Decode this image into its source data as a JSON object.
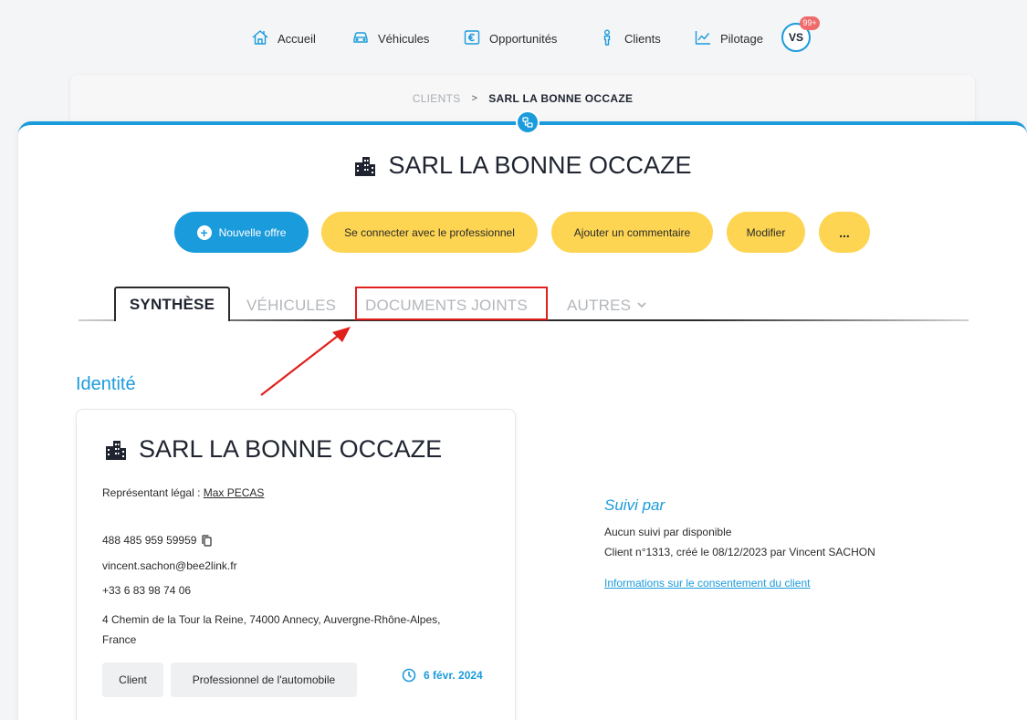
{
  "nav": {
    "items": [
      {
        "label": "Accueil",
        "icon": "home-icon"
      },
      {
        "label": "Véhicules",
        "icon": "car-icon"
      },
      {
        "label": "Opportunités",
        "icon": "euro-icon"
      },
      {
        "label": "Clients",
        "icon": "person-icon"
      },
      {
        "label": "Pilotage",
        "icon": "chart-icon"
      }
    ],
    "avatar_initials": "VS",
    "notification_count": "99+"
  },
  "breadcrumb": {
    "parent": "CLIENTS",
    "separator": ">",
    "current": "SARL LA BONNE OCCAZE"
  },
  "page": {
    "title": "SARL LA BONNE OCCAZE"
  },
  "actions": {
    "new_offer": "Nouvelle offre",
    "connect": "Se connecter avec le professionnel",
    "comment": "Ajouter un commentaire",
    "modify": "Modifier",
    "more": "..."
  },
  "tabs": {
    "synthese": "SYNTHÈSE",
    "vehicules": "VÉHICULES",
    "documents": "DOCUMENTS JOINTS",
    "autres": "AUTRES",
    "active": "SYNTHÈSE",
    "highlighted": "DOCUMENTS JOINTS"
  },
  "identity": {
    "section_title": "Identité",
    "company_name": "SARL LA BONNE OCCAZE",
    "legal_rep_label": "Représentant légal :",
    "legal_rep_name": "Max PECAS",
    "siret": "488 485 959 59959",
    "email": "vincent.sachon@bee2link.fr",
    "phone": "+33 6 83 98 74 06",
    "address": "4 Chemin de la Tour la Reine, 74000 Annecy, Auvergne-Rhône-Alpes, France",
    "tags": [
      "Client",
      "Professionnel de l'automobile"
    ],
    "date": "6 févr. 2024"
  },
  "suivi": {
    "title": "Suivi par",
    "none_text": "Aucun suivi par disponible",
    "meta_text": "Client n°1313, créé le 08/12/2023 par Vincent SACHON",
    "consent_link": "Informations sur le consentement du client"
  },
  "colors": {
    "accent_blue": "#1a9bdb",
    "button_yellow": "#fdd552",
    "annotation_red": "#e0201c",
    "badge_red": "#ef6b6b"
  }
}
